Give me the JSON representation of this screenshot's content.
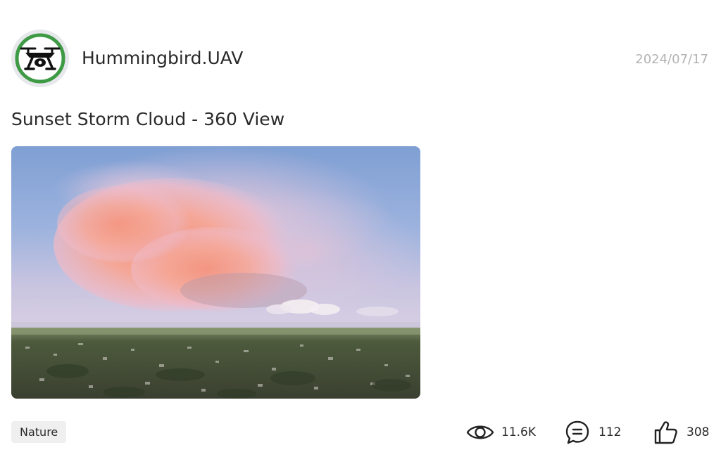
{
  "post": {
    "author": "Hummingbird.UAV",
    "date": "2024/07/17",
    "title": "Sunset Storm Cloud - 360 View",
    "tag": "Nature",
    "stats": {
      "views": "11.6K",
      "comments": "112",
      "likes": "308"
    }
  },
  "icons": {
    "avatar": "drone-logo-icon",
    "views": "eye-icon",
    "comments": "comment-bubble-icon",
    "likes": "thumbs-up-icon"
  },
  "colors": {
    "avatar_ring": "#3f9a45",
    "tag_bg": "#efefef",
    "date": "#b3b3b3"
  }
}
